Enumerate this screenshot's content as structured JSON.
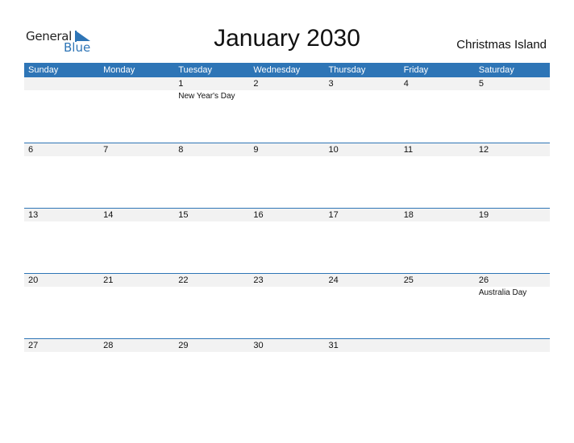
{
  "logo": {
    "line1": "General",
    "line2": "Blue"
  },
  "title": "January 2030",
  "region": "Christmas Island",
  "colors": {
    "accent": "#2e75b6",
    "date_strip": "#f2f2f2"
  },
  "weekdays": [
    "Sunday",
    "Monday",
    "Tuesday",
    "Wednesday",
    "Thursday",
    "Friday",
    "Saturday"
  ],
  "weeks": [
    [
      {
        "d": ""
      },
      {
        "d": ""
      },
      {
        "d": "1",
        "h": "New Year's Day"
      },
      {
        "d": "2"
      },
      {
        "d": "3"
      },
      {
        "d": "4"
      },
      {
        "d": "5"
      }
    ],
    [
      {
        "d": "6"
      },
      {
        "d": "7"
      },
      {
        "d": "8"
      },
      {
        "d": "9"
      },
      {
        "d": "10"
      },
      {
        "d": "11"
      },
      {
        "d": "12"
      }
    ],
    [
      {
        "d": "13"
      },
      {
        "d": "14"
      },
      {
        "d": "15"
      },
      {
        "d": "16"
      },
      {
        "d": "17"
      },
      {
        "d": "18"
      },
      {
        "d": "19"
      }
    ],
    [
      {
        "d": "20"
      },
      {
        "d": "21"
      },
      {
        "d": "22"
      },
      {
        "d": "23"
      },
      {
        "d": "24"
      },
      {
        "d": "25"
      },
      {
        "d": "26",
        "h": "Australia Day"
      }
    ],
    [
      {
        "d": "27"
      },
      {
        "d": "28"
      },
      {
        "d": "29"
      },
      {
        "d": "30"
      },
      {
        "d": "31"
      },
      {
        "d": ""
      },
      {
        "d": ""
      }
    ]
  ]
}
